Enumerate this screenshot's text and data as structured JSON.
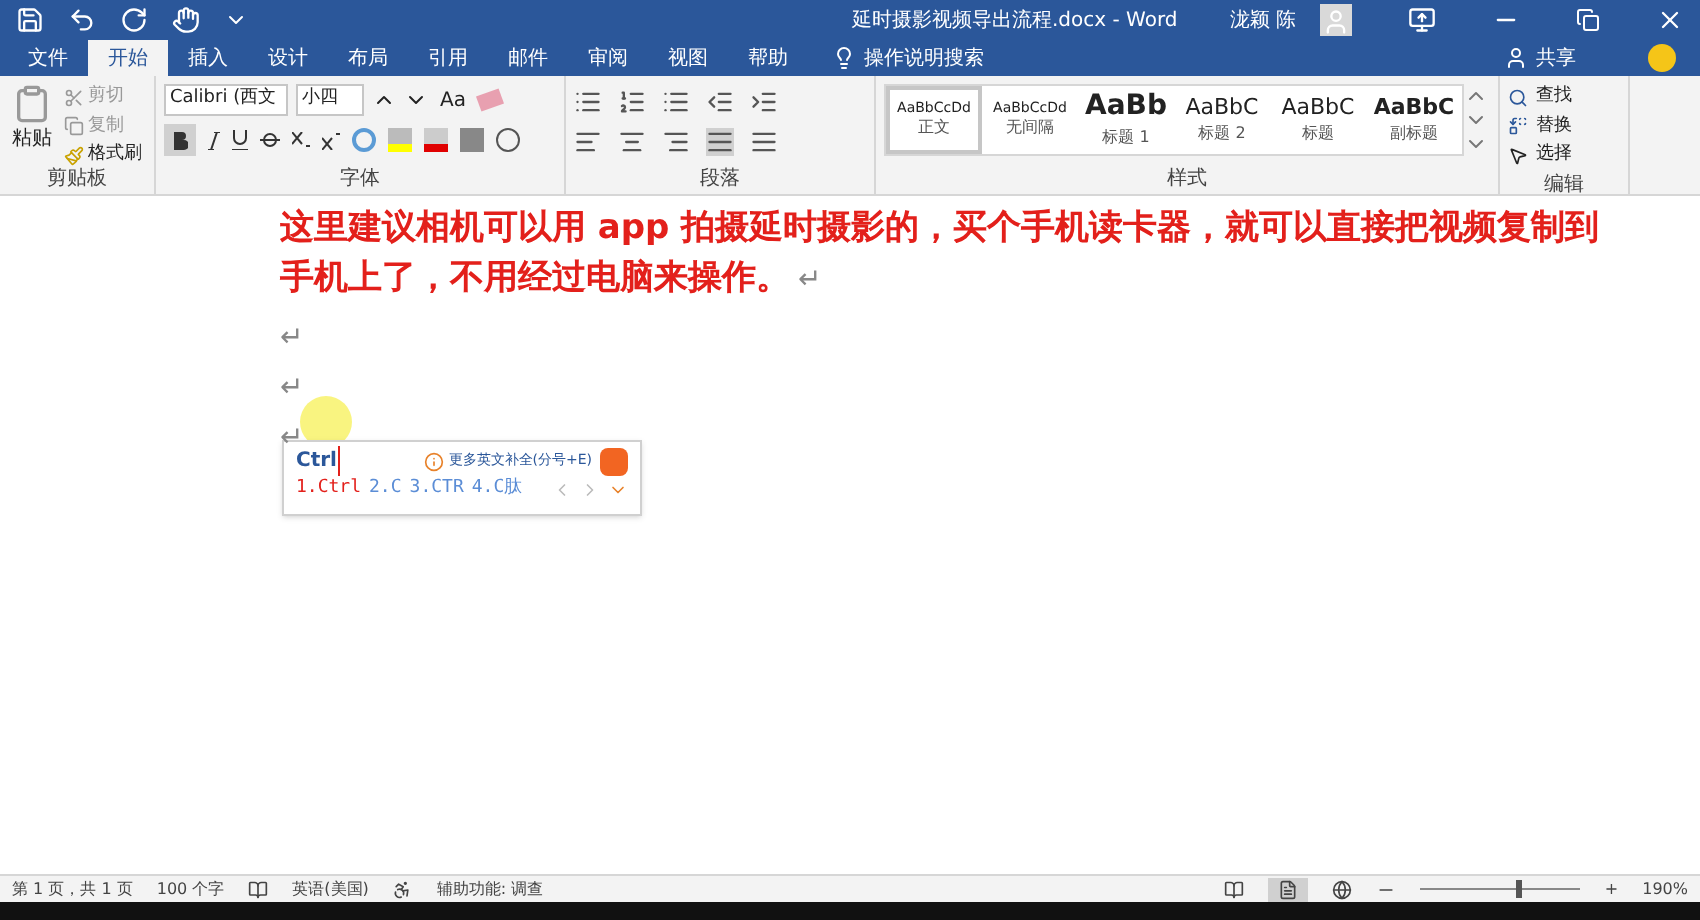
{
  "title_bar": {
    "title": "延时摄影视频导出流程.docx - Word",
    "user": "泷颖 陈"
  },
  "tabs": [
    {
      "label": "文件",
      "selected": false
    },
    {
      "label": "开始",
      "selected": true
    },
    {
      "label": "插入",
      "selected": false
    },
    {
      "label": "设计",
      "selected": false
    },
    {
      "label": "布局",
      "selected": false
    },
    {
      "label": "引用",
      "selected": false
    },
    {
      "label": "邮件",
      "selected": false
    },
    {
      "label": "审阅",
      "selected": false
    },
    {
      "label": "视图",
      "selected": false
    },
    {
      "label": "帮助",
      "selected": false
    }
  ],
  "tell_me": "操作说明搜索",
  "share": "共享",
  "clipboard": {
    "paste": "粘贴",
    "cut": "剪切",
    "copy": "复制",
    "format_painter": "格式刷",
    "label": "剪贴板"
  },
  "font": {
    "font_name": "Calibri (西文",
    "size": "小四",
    "case": "Aa",
    "label": "字体"
  },
  "paragraph": {
    "label": "段落"
  },
  "styles": {
    "label": "样式",
    "items": [
      {
        "preview": "AaBbCcDd",
        "name": "正文",
        "selected": true,
        "kind": "small"
      },
      {
        "preview": "AaBbCcDd",
        "name": "无间隔",
        "selected": false,
        "kind": "small"
      },
      {
        "preview": "AaBb",
        "name": "标题 1",
        "selected": false,
        "kind": "heavy"
      },
      {
        "preview": "AaBbC",
        "name": "标题 2",
        "selected": false,
        "kind": "medium"
      },
      {
        "preview": "AaBbC",
        "name": "标题",
        "selected": false,
        "kind": "medium"
      },
      {
        "preview": "AaBbC",
        "name": "副标题",
        "selected": false,
        "kind": "bold"
      }
    ]
  },
  "editing": {
    "find": "查找",
    "replace": "替换",
    "select": "选择",
    "label": "编辑"
  },
  "document": {
    "paragraphs": [
      {
        "text": "这里建议相机可以用 app 拍摄延时摄影的，买个手机读卡器，就可以直接把视频复制到手机上了，不用经过电脑来操作。",
        "mark": "↵"
      },
      {
        "mark": "↵"
      },
      {
        "mark": "↵"
      },
      {
        "mark": "↵"
      }
    ]
  },
  "ime": {
    "input": "Ctrl",
    "hint": "更多英文补全(分号+E)",
    "candidates": [
      {
        "label": "1.Ctrl",
        "selected": true
      },
      {
        "label": "2.C",
        "selected": false
      },
      {
        "label": "3.CTR",
        "selected": false
      },
      {
        "label": "4.C肽",
        "selected": false
      }
    ]
  },
  "status_bar": {
    "page": "第 1 页，共 1 页",
    "words": "100 个字",
    "language": "英语(美国)",
    "accessibility": "辅助功能: 调查",
    "zoom_in": "+",
    "zoom": "190%",
    "zoom_level": {
      "level": 0.6
    }
  }
}
